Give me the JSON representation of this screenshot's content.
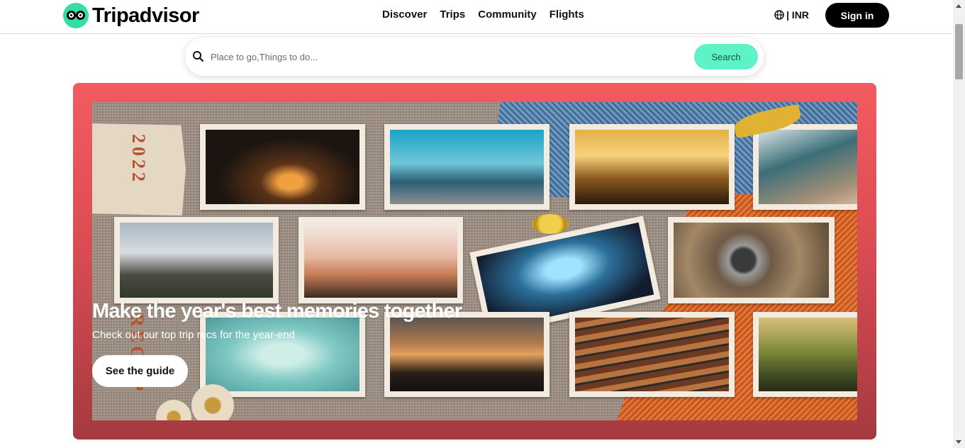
{
  "header": {
    "brand": "Tripadvisor",
    "nav": [
      {
        "label": "Discover"
      },
      {
        "label": "Trips"
      },
      {
        "label": "Community"
      },
      {
        "label": "Flights"
      }
    ],
    "currency_label": "| INR",
    "signin_label": "Sign in"
  },
  "search": {
    "placeholder": "Place to go,Things to do...",
    "value": "",
    "button_label": "Search"
  },
  "hero": {
    "year_text": "2022",
    "recap_text": "RECAP",
    "title": "Make the year's best memories together",
    "subtitle": "Check out our top trip recs for the year-end",
    "cta_label": "See the guide"
  },
  "colors": {
    "brand_green": "#34e0a1",
    "search_button": "#5ef3c6",
    "hero_top": "#f25c60",
    "hero_bottom": "#a43a3f",
    "signin_bg": "#000000"
  }
}
